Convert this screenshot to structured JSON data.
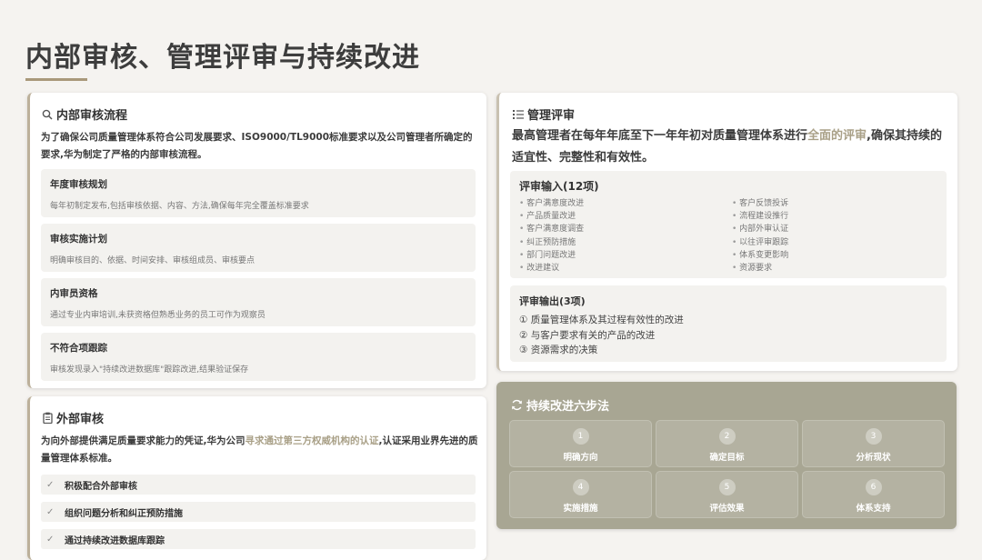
{
  "page": {
    "title": "内部审核、管理评审与持续改进"
  },
  "internal_audit": {
    "title": "内部审核流程",
    "intro": "为了确保公司质量管理体系符合公司发展要求、ISO9000/TL9000标准要求以及公司管理者所确定的要求,华为制定了严格的内部审核流程。",
    "items": [
      {
        "heading": "年度审核规划",
        "desc": "每年初制定发布,包括审核依据、内容、方法,确保每年完全覆盖标准要求"
      },
      {
        "heading": "审核实施计划",
        "desc": "明确审核目的、依据、时间安排、审核组成员、审核要点"
      },
      {
        "heading": "内审员资格",
        "desc": "通过专业内审培训,未获资格但熟悉业务的员工可作为观察员"
      },
      {
        "heading": "不符合项跟踪",
        "desc": "审核发现录入\"持续改进数据库\"跟踪改进,结果验证保存"
      }
    ]
  },
  "external_audit": {
    "title": "外部审核",
    "intro_pre": "为向外部提供满足质量要求能力的凭证,华为公司",
    "intro_hl": "寻求通过第三方权威机构的认证",
    "intro_post": ",认证采用业界先进的质量管理体系标准。",
    "checks": [
      "积极配合外部审核",
      "组织问题分析和纠正预防措施",
      "通过持续改进数据库跟踪"
    ]
  },
  "mgmt_review": {
    "title": "管理评审",
    "intro_pre": "最高管理者在每年年底至下一年年初对质量管理体系进行",
    "intro_hl": "全面的评审",
    "intro_post": ",确保其持续的适宜性、完整性和有效性。",
    "inputs_title": "评审输入(12项)",
    "inputs_left": [
      "客户满意度改进",
      "产品质量改进",
      "客户满意度调查",
      "纠正预防措施",
      "部门问题改进",
      "改进建议"
    ],
    "inputs_right": [
      "客户反馈投诉",
      "流程建设推行",
      "内部外审认证",
      "以往评审跟踪",
      "体系变更影响",
      "资源要求"
    ],
    "outputs_title": "评审输出(3项)",
    "outputs": [
      "① 质量管理体系及其过程有效性的改进",
      "② 与客户要求有关的产品的改进",
      "③ 资源需求的决策"
    ]
  },
  "six_steps": {
    "title": "持续改进六步法",
    "steps": [
      {
        "num": "1",
        "label": "明确方向"
      },
      {
        "num": "2",
        "label": "确定目标"
      },
      {
        "num": "3",
        "label": "分析现状"
      },
      {
        "num": "4",
        "label": "实施措施"
      },
      {
        "num": "5",
        "label": "评估效果"
      },
      {
        "num": "6",
        "label": "体系支持"
      }
    ]
  },
  "icons": {
    "search": "search-icon",
    "list": "list-icon",
    "clipboard": "clipboard-icon",
    "refresh": "refresh-icon",
    "check": "check-icon"
  },
  "colors": {
    "accent": "#a9987a",
    "highlight": "#a9a087",
    "steps_panel": "#a8a693"
  }
}
